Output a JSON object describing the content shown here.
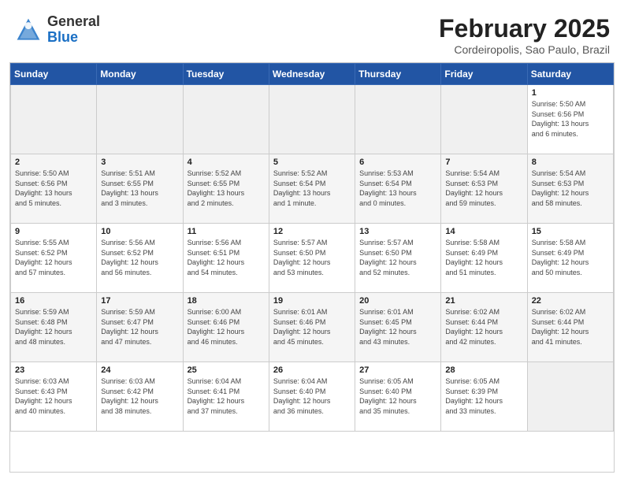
{
  "header": {
    "logo_general": "General",
    "logo_blue": "Blue",
    "month_title": "February 2025",
    "location": "Cordeiropolis, Sao Paulo, Brazil"
  },
  "days_of_week": [
    "Sunday",
    "Monday",
    "Tuesday",
    "Wednesday",
    "Thursday",
    "Friday",
    "Saturday"
  ],
  "weeks": [
    [
      {
        "day": "",
        "info": ""
      },
      {
        "day": "",
        "info": ""
      },
      {
        "day": "",
        "info": ""
      },
      {
        "day": "",
        "info": ""
      },
      {
        "day": "",
        "info": ""
      },
      {
        "day": "",
        "info": ""
      },
      {
        "day": "1",
        "info": "Sunrise: 5:50 AM\nSunset: 6:56 PM\nDaylight: 13 hours\nand 6 minutes."
      }
    ],
    [
      {
        "day": "2",
        "info": "Sunrise: 5:50 AM\nSunset: 6:56 PM\nDaylight: 13 hours\nand 5 minutes."
      },
      {
        "day": "3",
        "info": "Sunrise: 5:51 AM\nSunset: 6:55 PM\nDaylight: 13 hours\nand 3 minutes."
      },
      {
        "day": "4",
        "info": "Sunrise: 5:52 AM\nSunset: 6:55 PM\nDaylight: 13 hours\nand 2 minutes."
      },
      {
        "day": "5",
        "info": "Sunrise: 5:52 AM\nSunset: 6:54 PM\nDaylight: 13 hours\nand 1 minute."
      },
      {
        "day": "6",
        "info": "Sunrise: 5:53 AM\nSunset: 6:54 PM\nDaylight: 13 hours\nand 0 minutes."
      },
      {
        "day": "7",
        "info": "Sunrise: 5:54 AM\nSunset: 6:53 PM\nDaylight: 12 hours\nand 59 minutes."
      },
      {
        "day": "8",
        "info": "Sunrise: 5:54 AM\nSunset: 6:53 PM\nDaylight: 12 hours\nand 58 minutes."
      }
    ],
    [
      {
        "day": "9",
        "info": "Sunrise: 5:55 AM\nSunset: 6:52 PM\nDaylight: 12 hours\nand 57 minutes."
      },
      {
        "day": "10",
        "info": "Sunrise: 5:56 AM\nSunset: 6:52 PM\nDaylight: 12 hours\nand 56 minutes."
      },
      {
        "day": "11",
        "info": "Sunrise: 5:56 AM\nSunset: 6:51 PM\nDaylight: 12 hours\nand 54 minutes."
      },
      {
        "day": "12",
        "info": "Sunrise: 5:57 AM\nSunset: 6:50 PM\nDaylight: 12 hours\nand 53 minutes."
      },
      {
        "day": "13",
        "info": "Sunrise: 5:57 AM\nSunset: 6:50 PM\nDaylight: 12 hours\nand 52 minutes."
      },
      {
        "day": "14",
        "info": "Sunrise: 5:58 AM\nSunset: 6:49 PM\nDaylight: 12 hours\nand 51 minutes."
      },
      {
        "day": "15",
        "info": "Sunrise: 5:58 AM\nSunset: 6:49 PM\nDaylight: 12 hours\nand 50 minutes."
      }
    ],
    [
      {
        "day": "16",
        "info": "Sunrise: 5:59 AM\nSunset: 6:48 PM\nDaylight: 12 hours\nand 48 minutes."
      },
      {
        "day": "17",
        "info": "Sunrise: 5:59 AM\nSunset: 6:47 PM\nDaylight: 12 hours\nand 47 minutes."
      },
      {
        "day": "18",
        "info": "Sunrise: 6:00 AM\nSunset: 6:46 PM\nDaylight: 12 hours\nand 46 minutes."
      },
      {
        "day": "19",
        "info": "Sunrise: 6:01 AM\nSunset: 6:46 PM\nDaylight: 12 hours\nand 45 minutes."
      },
      {
        "day": "20",
        "info": "Sunrise: 6:01 AM\nSunset: 6:45 PM\nDaylight: 12 hours\nand 43 minutes."
      },
      {
        "day": "21",
        "info": "Sunrise: 6:02 AM\nSunset: 6:44 PM\nDaylight: 12 hours\nand 42 minutes."
      },
      {
        "day": "22",
        "info": "Sunrise: 6:02 AM\nSunset: 6:44 PM\nDaylight: 12 hours\nand 41 minutes."
      }
    ],
    [
      {
        "day": "23",
        "info": "Sunrise: 6:03 AM\nSunset: 6:43 PM\nDaylight: 12 hours\nand 40 minutes."
      },
      {
        "day": "24",
        "info": "Sunrise: 6:03 AM\nSunset: 6:42 PM\nDaylight: 12 hours\nand 38 minutes."
      },
      {
        "day": "25",
        "info": "Sunrise: 6:04 AM\nSunset: 6:41 PM\nDaylight: 12 hours\nand 37 minutes."
      },
      {
        "day": "26",
        "info": "Sunrise: 6:04 AM\nSunset: 6:40 PM\nDaylight: 12 hours\nand 36 minutes."
      },
      {
        "day": "27",
        "info": "Sunrise: 6:05 AM\nSunset: 6:40 PM\nDaylight: 12 hours\nand 35 minutes."
      },
      {
        "day": "28",
        "info": "Sunrise: 6:05 AM\nSunset: 6:39 PM\nDaylight: 12 hours\nand 33 minutes."
      },
      {
        "day": "",
        "info": ""
      }
    ]
  ]
}
